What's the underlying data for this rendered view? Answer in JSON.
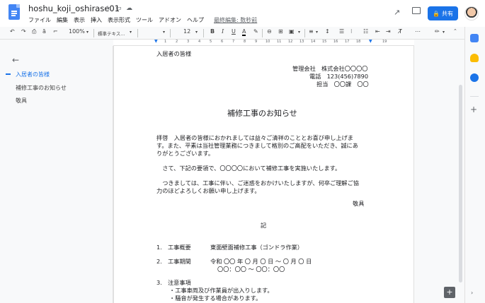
{
  "app": {
    "doc_title": "hoshu_koji_oshirase01",
    "menu": [
      "ファイル",
      "編集",
      "表示",
      "挿入",
      "表示形式",
      "ツール",
      "アドオン",
      "ヘルプ"
    ],
    "last_edit": "最終編集: 数秒前",
    "share_label": "共有"
  },
  "toolbar": {
    "zoom": "100%",
    "style": "標準テキス...",
    "font_size": "12"
  },
  "ruler": {
    "numbers": [
      "1",
      "2",
      "3",
      "4",
      "5",
      "6",
      "7",
      "8",
      "9",
      "10",
      "11",
      "12",
      "13",
      "14",
      "15",
      "16",
      "17",
      "18",
      "19"
    ]
  },
  "outline": {
    "items": [
      "入居者の皆様",
      "補修工事のお知らせ",
      "敬具"
    ]
  },
  "doc": {
    "recipient": "入居者の皆様",
    "sender_company": "管理会社　株式会社〇〇〇〇",
    "sender_phone": "電話　123(456)7890",
    "sender_person": "担当　〇〇課　〇〇",
    "title": "補修工事のお知らせ",
    "para1_line1": "拝啓　入居者の皆様におかれましては益々ご清祥のこととお喜び申し上げま",
    "para1_line2": "す。また、平素は当社管理業務につきまして格別のご高配をいただき、誠にあ",
    "para1_line3": "りがとうございます。",
    "para2": "　さて、下記の要領で、〇〇〇〇において補修工事を実施いたします。",
    "para3_line1": "　つきましては、工事に伴い、ご迷惑をおかけいたしますが、何卒ご理解ご協",
    "para3_line2": "力のほどよろしくお願い申し上げます。",
    "closing": "敬具",
    "ki": "記",
    "item1_label": "1.　工事概要",
    "item1_value": "東面壁面補修工事（ゴンドラ作業）",
    "item2_label": "2.　工事期間",
    "item2_value_line1": "令和 〇〇 年 〇 月 〇 日 ～ 〇 月 〇 日",
    "item2_value_line2": "〇〇：〇〇 ～ 〇〇：〇〇",
    "item3_label": "3.　注意事項",
    "item3_bullet1": "・工事車両及び作業員が出入りします。",
    "item3_bullet2": "・騒音が発生する場合があります。"
  }
}
